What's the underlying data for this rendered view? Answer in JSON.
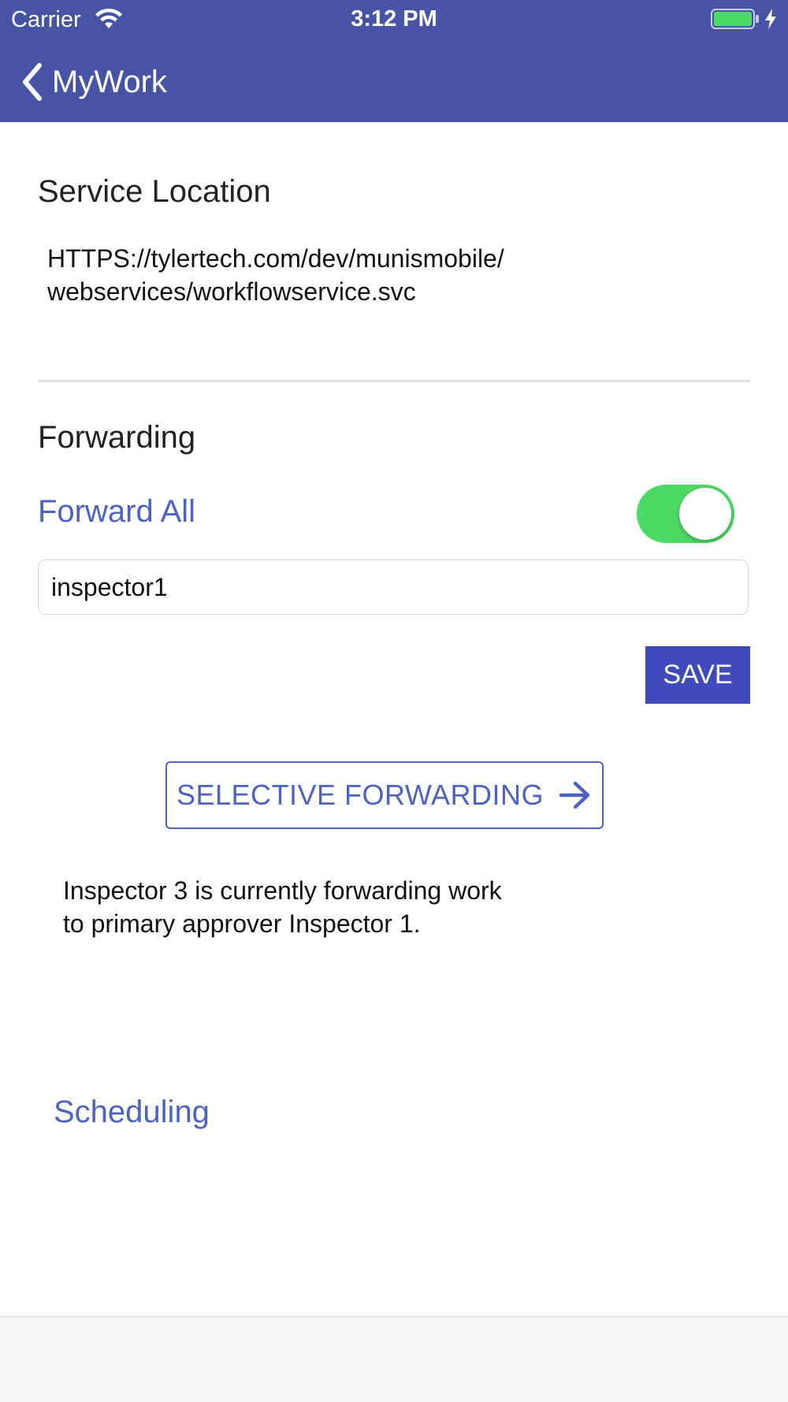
{
  "status_bar": {
    "carrier": "Carrier",
    "time": "3:12 PM",
    "battery_color": "#4cd964"
  },
  "header": {
    "back_label": "MyWork",
    "background_color": "#4753a5"
  },
  "service_location": {
    "title": "Service Location",
    "url_line1": "HTTPS://tylertech.com/dev/munismobile/",
    "url_line2": "webservices/workflowservice.svc"
  },
  "forwarding": {
    "title": "Forwarding",
    "forward_all_label": "Forward All",
    "forward_all_enabled": true,
    "toggle_color": "#4cd964",
    "input_value": "inspector1",
    "save_label": "SAVE",
    "selective_label": "SELECTIVE FORWARDING",
    "status_line1": "Inspector 3 is currently forwarding work",
    "status_line2": "to primary approver Inspector 1."
  },
  "scheduling": {
    "label": "Scheduling"
  },
  "icons": {
    "back": "chevron-left-icon",
    "wifi": "wifi-icon",
    "battery": "battery-icon",
    "charging": "bolt-icon",
    "selective_arrow": "arrow-right-icon"
  },
  "accent_color": "#4d63c1"
}
